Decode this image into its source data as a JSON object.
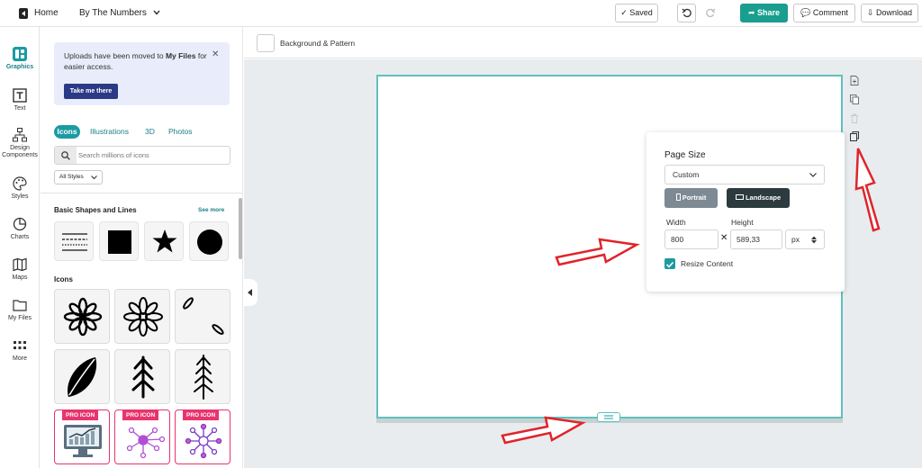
{
  "topbar": {
    "home_label": "Home",
    "doc_title": "By The Numbers",
    "saved_label": "Saved",
    "share_label": "Share",
    "comment_label": "Comment",
    "download_label": "Download"
  },
  "rail": {
    "items": [
      {
        "label": "Graphics",
        "icon": "graphics-icon"
      },
      {
        "label": "Text",
        "icon": "text-icon"
      },
      {
        "label": "Design Components",
        "icon": "components-icon"
      },
      {
        "label": "Styles",
        "icon": "palette-icon"
      },
      {
        "label": "Charts",
        "icon": "chart-icon"
      },
      {
        "label": "Maps",
        "icon": "map-icon"
      },
      {
        "label": "My Files",
        "icon": "folder-icon"
      },
      {
        "label": "More",
        "icon": "grid-icon"
      }
    ],
    "accent": "#1b9ba1"
  },
  "panel": {
    "notice_prefix": "Uploads have been moved to ",
    "notice_bold": "My Files",
    "notice_suffix": " for easier access.",
    "notice_button": "Take me there",
    "tabs": [
      "Icons",
      "Illustrations",
      "3D",
      "Photos"
    ],
    "search_placeholder": "Search millions of icons",
    "styles_filter": "All Styles",
    "section_shapes": "Basic Shapes and Lines",
    "see_more": "See more",
    "section_icons": "Icons",
    "pro_badge": "PRO ICON"
  },
  "editor": {
    "background_label": "Background & Pattern"
  },
  "page_size": {
    "title": "Page Size",
    "preset": "Custom",
    "portrait_label": "Portrait",
    "landscape_label": "Landscape",
    "width_label": "Width",
    "height_label": "Height",
    "width_value": "800",
    "height_value": "589,33",
    "unit": "px",
    "resize_label": "Resize Content",
    "resize_checked": true
  },
  "colors": {
    "teal": "#1b9ba1",
    "navy": "#2b3a86",
    "pro": "#e8346e",
    "arrow": "#e0242b"
  }
}
